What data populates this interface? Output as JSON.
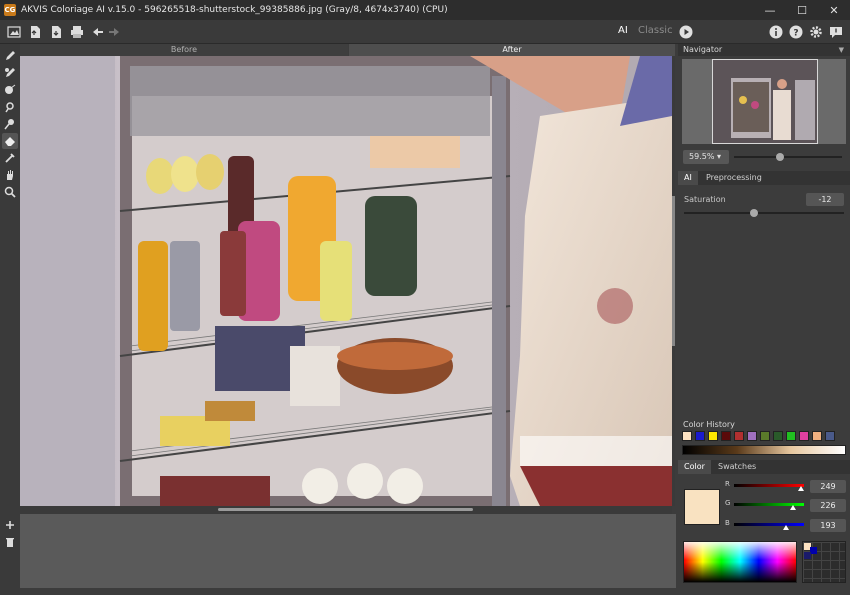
{
  "window": {
    "title": "AKVIS Coloriage AI v.15.0 - 596265518-shutterstock_99385886.jpg (Gray/8, 4674x3740) (CPU)",
    "logo_text": "CG",
    "minimize": "—",
    "maximize": "☐",
    "close": "✕"
  },
  "toolbar": {
    "mode_ai": "AI",
    "mode_classic": "Classic"
  },
  "view_tabs": {
    "before": "Before",
    "after": "After"
  },
  "navigator": {
    "title": "Navigator",
    "zoom": "59.5% ▾",
    "zoom_level": 0.61
  },
  "settings": {
    "tabs": [
      "AI",
      "Preprocessing"
    ],
    "active_tab": "AI",
    "saturation_label": "Saturation",
    "saturation_value": "-12",
    "saturation_level": 0.45
  },
  "color_history": {
    "title": "Color History",
    "swatches": [
      "#fde2c1",
      "#1a1acc",
      "#ffe800",
      "#5a0a0a",
      "#b03030",
      "#a070c0",
      "#5a7a2a",
      "#2a5a2a",
      "#20c020",
      "#e040a0",
      "#f0b080",
      "#4a5a8a"
    ]
  },
  "color_panel": {
    "tabs": [
      "Color",
      "Swatches"
    ],
    "active_tab": "Color",
    "current_color": "#f9e2c1",
    "r_label": "R",
    "g_label": "G",
    "b_label": "B",
    "r": "249",
    "g": "226",
    "b": "193"
  },
  "colors": {
    "accent_white": "#ffffff",
    "panel_bg": "#3c3c3c"
  }
}
